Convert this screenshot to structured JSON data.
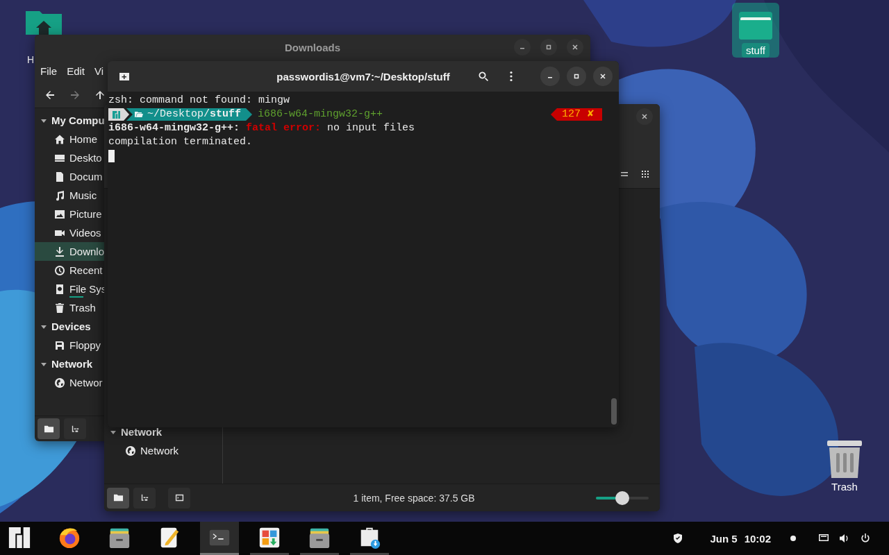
{
  "desktop_icons": [
    {
      "label": "H",
      "kind": "home-folder",
      "selected": false
    },
    {
      "label": "stuff",
      "kind": "folder",
      "selected": true
    },
    {
      "label": "Trash",
      "kind": "trash",
      "selected": false
    }
  ],
  "file_manager_back": {
    "title": "Downloads",
    "menu": [
      "File",
      "Edit",
      "Vi"
    ],
    "nav": [
      {
        "kind": "back",
        "disabled": false
      },
      {
        "kind": "forward",
        "disabled": true
      },
      {
        "kind": "up",
        "disabled": false
      }
    ],
    "sidebar": [
      {
        "title": "My Compu",
        "expanded": true,
        "items": [
          {
            "label": "Home",
            "kind": "home",
            "selected": false
          },
          {
            "label": "Deskto",
            "kind": "desktop",
            "selected": false
          },
          {
            "label": "Docum",
            "kind": "document",
            "selected": false
          },
          {
            "label": "Music",
            "kind": "music",
            "selected": false
          },
          {
            "label": "Picture",
            "kind": "pictures",
            "selected": false
          },
          {
            "label": "Videos",
            "kind": "videos",
            "selected": false
          },
          {
            "label": "Downlo",
            "kind": "download",
            "selected": true
          },
          {
            "label": "Recent",
            "kind": "recent",
            "selected": false
          },
          {
            "label": "File Sys",
            "kind": "filesystem",
            "selected": false,
            "level": 0.4
          },
          {
            "label": "Trash",
            "kind": "trash",
            "selected": false
          }
        ]
      },
      {
        "title": "Devices",
        "expanded": true,
        "items": [
          {
            "label": "Floppy",
            "kind": "floppy",
            "selected": false
          }
        ]
      },
      {
        "title": "Network",
        "expanded": true,
        "items": [
          {
            "label": "Networ",
            "kind": "network",
            "selected": false
          }
        ]
      }
    ],
    "bottom_buttons": [
      {
        "kind": "places",
        "selected": true
      },
      {
        "kind": "tree",
        "selected": false
      }
    ]
  },
  "file_manager_front": {
    "sidebar": [
      {
        "title": "Network",
        "expanded": true,
        "items": [
          {
            "label": "Network",
            "kind": "network",
            "selected": false
          }
        ]
      }
    ],
    "view_buttons": [
      {
        "kind": "list"
      },
      {
        "kind": "grid"
      }
    ],
    "bottom_buttons": [
      {
        "kind": "places",
        "selected": true
      },
      {
        "kind": "tree",
        "selected": false
      },
      {
        "kind": "sidebar-toggle",
        "selected": false
      }
    ],
    "status": "1 item, Free space: 37.5 GB",
    "zoom": {
      "level": 0.5
    }
  },
  "terminal": {
    "title": "passwordis1@vm7:~/Desktop/stuff",
    "lines": [
      {
        "kind": "output",
        "text": "zsh: command not found: mingw"
      },
      {
        "kind": "prompt",
        "path": "~/Desktop/**stuff**",
        "command": "i686-w64-mingw32-g++",
        "status": "127",
        "status_mark": "✘"
      },
      {
        "kind": "error",
        "program": "i686-w64-mingw32-g++:",
        "label": "fatal error:",
        "message": "no input files"
      },
      {
        "kind": "output",
        "text": "compilation terminated."
      },
      {
        "kind": "cursor"
      }
    ]
  },
  "taskbar": {
    "apps": [
      {
        "kind": "menu",
        "running": false,
        "active": false
      },
      {
        "kind": "browser",
        "running": false,
        "active": false
      },
      {
        "kind": "files",
        "running": false,
        "active": false
      },
      {
        "kind": "editor",
        "running": false,
        "active": false
      },
      {
        "kind": "terminal",
        "running": true,
        "active": true
      },
      {
        "kind": "software",
        "running": true,
        "active": false
      },
      {
        "kind": "files",
        "running": true,
        "active": false
      },
      {
        "kind": "store",
        "running": true,
        "active": false
      }
    ],
    "date": "Jun 5",
    "time": "10:02"
  }
}
